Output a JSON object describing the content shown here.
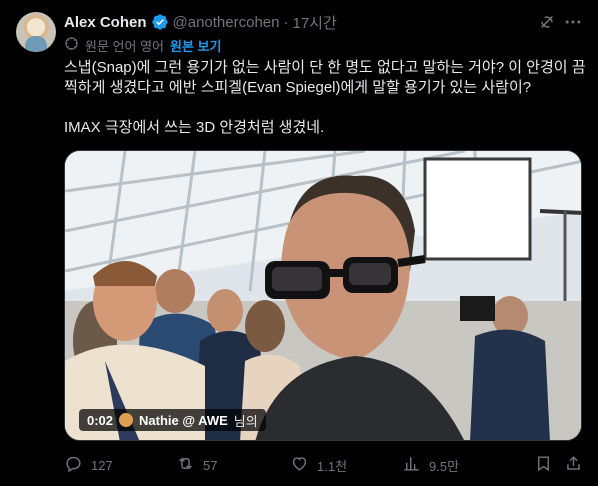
{
  "tweet": {
    "author_name": "Alex Cohen",
    "handle": "@anothercohen",
    "separator": "·",
    "time": "17시간",
    "translate_label": "원문 언어 영어",
    "translate_link": "원본 보기",
    "text_lines": [
      "스냅(Snap)에 그런 용기가 없는 사람이 단 한 명도 없다고 말하는 거야? 이 안경이 끔",
      "찍하게 생겼다고 에반 스피겔(Evan Spiegel)에게 말할 용기가 있는 사람이?",
      "IMAX 극장에서 쓰는 3D 안경처럼 생겼네."
    ],
    "video": {
      "time_code": "0:02",
      "tagged_user": "Nathie @ AWE",
      "tagged_suffix": "님의"
    },
    "metrics": {
      "replies": "127",
      "retweets": "57",
      "likes": "1.1천",
      "views": "9.5만"
    }
  },
  "icons": {
    "verified": "verified-badge-icon",
    "grok": "grok-icon",
    "more": "more-icon",
    "translate": "translate-icon",
    "reply": "reply-icon",
    "retweet": "retweet-icon",
    "like": "heart-icon",
    "views": "views-icon",
    "bookmark": "bookmark-icon",
    "share": "share-icon"
  },
  "colors": {
    "background": "#000000",
    "text": "#e7e9ea",
    "muted": "#71767b",
    "accent": "#1d9bf0"
  }
}
